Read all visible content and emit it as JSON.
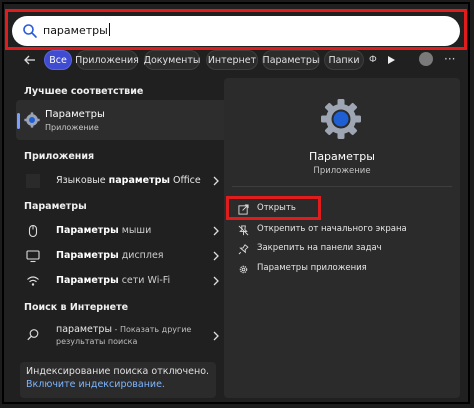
{
  "search": {
    "query": "параметры"
  },
  "filters": [
    "Все",
    "Приложения",
    "Документы",
    "Интернет",
    "Параметры",
    "Папки"
  ],
  "more_chip": "Ф",
  "best_match": {
    "section": "Лучшее соответствие",
    "title": "Параметры",
    "subtitle": "Приложение"
  },
  "apps": {
    "section": "Приложения",
    "item_pre": "Языковые ",
    "item_bold": "параметры",
    "item_post": " Office"
  },
  "settings": {
    "section": "Параметры",
    "items": [
      {
        "bold": "Параметры",
        "rest": " мыши",
        "icon": "mouse-icon"
      },
      {
        "bold": "Параметры",
        "rest": " дисплея",
        "icon": "display-icon"
      },
      {
        "bold": "Параметры",
        "rest": " сети Wi-Fi",
        "icon": "wifi-icon"
      }
    ]
  },
  "web": {
    "section": "Поиск в Интернете",
    "query": "параметры",
    "hint": " - Показать другие результаты поиска"
  },
  "indexing": {
    "notice": "Индексирование поиска отключено.",
    "link": "Включите индексирование."
  },
  "detail": {
    "title": "Параметры",
    "subtitle": "Приложение",
    "actions": [
      {
        "label": "Открыть",
        "icon": "open-external-icon"
      },
      {
        "label": "Открепить от начального экрана",
        "icon": "unpin-icon"
      },
      {
        "label": "Закрепить на панели задач",
        "icon": "pin-icon"
      },
      {
        "label": "Параметры приложения",
        "icon": "gear-icon"
      }
    ]
  },
  "colors": {
    "accent": "#3f4bd1",
    "highlight": "#e01c1c",
    "link": "#7eb6ff"
  }
}
